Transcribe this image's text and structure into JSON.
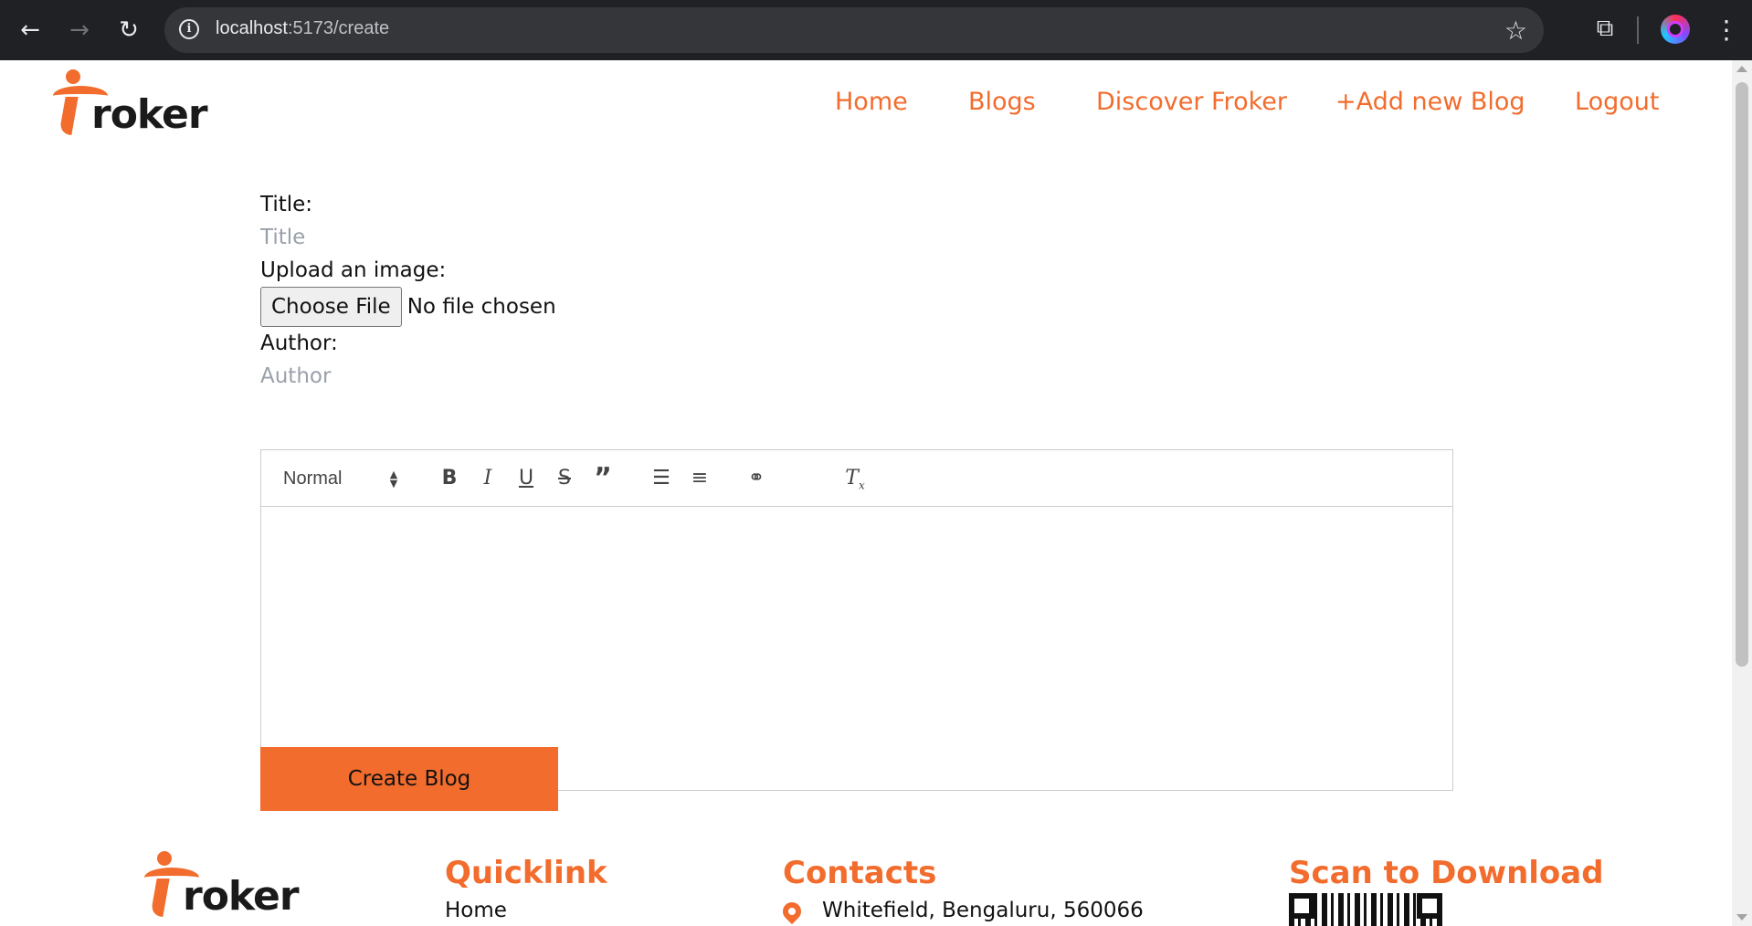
{
  "browser": {
    "url_host": "localhost",
    "url_path": ":5173/create",
    "back_icon": "arrow-left-icon",
    "forward_icon": "arrow-right-icon",
    "reload_icon": "reload-icon",
    "info_icon": "info-icon",
    "star_icon": "star-icon",
    "extensions_icon": "puzzle-icon",
    "menu_icon": "kebab-menu-icon"
  },
  "brand": {
    "logo_text": "roker",
    "accent_color": "#f26c2d"
  },
  "nav": {
    "items": [
      {
        "label": "Home"
      },
      {
        "label": "Blogs"
      },
      {
        "label": "Discover Froker"
      },
      {
        "label": "+Add new Blog"
      },
      {
        "label": "Logout"
      }
    ]
  },
  "form": {
    "title_label": "Title:",
    "title_placeholder": "Title",
    "title_value": "",
    "image_label": "Upload an image:",
    "file_button": "Choose File",
    "file_status": "No file chosen",
    "author_label": "Author:",
    "author_placeholder": "Author",
    "author_value": "",
    "editor": {
      "heading_select": "Normal",
      "tools": [
        "bold-icon",
        "italic-icon",
        "underline-icon",
        "strikethrough-icon",
        "blockquote-icon",
        "ordered-list-icon",
        "bullet-list-icon",
        "link-icon",
        "clear-format-icon"
      ],
      "content": ""
    },
    "submit_label": "Create Blog"
  },
  "footer": {
    "quicklink_title": "Quicklink",
    "quicklink_first": "Home",
    "contacts_title": "Contacts",
    "address": "Whitefield, Bengaluru, 560066",
    "download_title": "Scan to Download"
  }
}
